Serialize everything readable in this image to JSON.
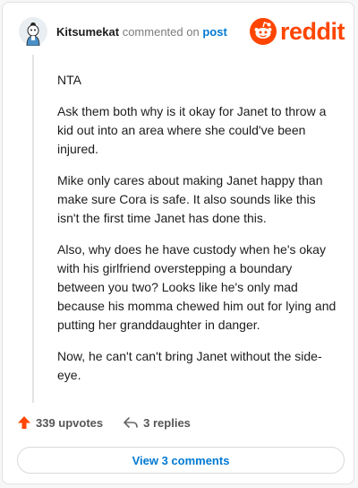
{
  "comment": {
    "username": "Kitsumekat",
    "verb": "commented on",
    "post_link": "post",
    "paragraphs": [
      "NTA",
      "Ask them both why is it okay for Janet to throw a kid out into an area where she could've been injured.",
      "Mike only cares about making Janet happy than make sure Cora is safe. It also sounds like this isn't the first time Janet has done this.",
      "Also, why does he have custody when he's okay with his girlfriend overstepping a boundary between you two? Looks like he's only mad because his momma chewed him out for lying and putting her granddaughter in danger.",
      "Now, he can't can't bring Janet without the side-eye."
    ]
  },
  "brand": {
    "wordmark": "reddit",
    "color": "#ff4500"
  },
  "actions": {
    "upvotes": "339 upvotes",
    "replies": "3 replies"
  },
  "view_comments": "View 3 comments",
  "colors": {
    "link": "#0079d3",
    "upvote": "#ff4500"
  }
}
